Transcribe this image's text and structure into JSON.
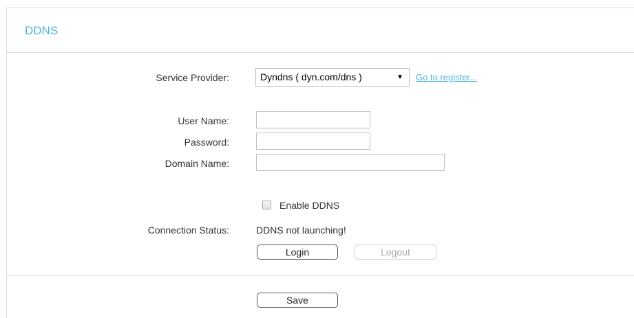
{
  "page": {
    "title": "DDNS"
  },
  "form": {
    "service_provider_label": "Service Provider:",
    "service_provider_value": "Dyndns ( dyn.com/dns )",
    "register_link": "Go to register...",
    "username_label": "User Name:",
    "username_value": "",
    "password_label": "Password:",
    "password_value": "",
    "domain_label": "Domain Name:",
    "domain_value": "",
    "enable_label": "Enable DDNS",
    "enable_checked": false,
    "status_label": "Connection Status:",
    "status_value": "DDNS not launching!",
    "login_label": "Login",
    "logout_label": "Logout",
    "save_label": "Save"
  },
  "colors": {
    "title": "#4fb3e0",
    "link": "#4fb3e0",
    "border": "#dcdcdc"
  },
  "icons": {
    "select_arrow": "triangle-down-icon"
  }
}
